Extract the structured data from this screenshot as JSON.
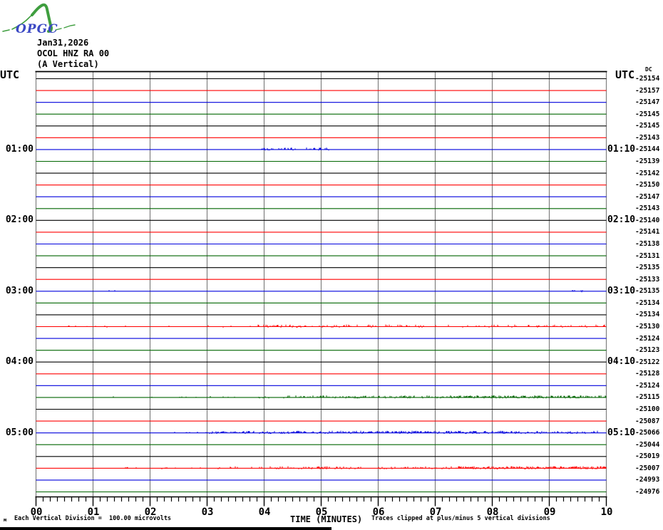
{
  "logo": {
    "text": "OPGC",
    "green": "#3f9e3f",
    "blue": "#3b49c4"
  },
  "header": {
    "date": "Jan31,2026",
    "station": "OCOL HNZ RA 00",
    "component": "(A Vertical)"
  },
  "axis_labels": {
    "utc_left": "UTC",
    "utc_right": "UTC",
    "dc": "DC",
    "x_title": "TIME (MINUTES)"
  },
  "footnotes": {
    "left_mark": "м",
    "left": "Each Vertical Division =  100.00 microvolts",
    "right": "Traces clipped at plus/minus 5 vertical divisions"
  },
  "x_ticks": [
    "00",
    "01",
    "02",
    "03",
    "04",
    "05",
    "06",
    "07",
    "08",
    "09",
    "10"
  ],
  "left_times": [
    {
      "row": 6,
      "label": "01:00"
    },
    {
      "row": 12,
      "label": "02:00"
    },
    {
      "row": 18,
      "label": "03:00"
    },
    {
      "row": 24,
      "label": "04:00"
    },
    {
      "row": 30,
      "label": "05:00"
    }
  ],
  "right_times": [
    {
      "row": 6,
      "label": "01:10"
    },
    {
      "row": 12,
      "label": "02:10"
    },
    {
      "row": 18,
      "label": "03:10"
    },
    {
      "row": 24,
      "label": "04:10"
    },
    {
      "row": 30,
      "label": "05:10"
    }
  ],
  "colors": {
    "grid": "#808080",
    "border": "#000000",
    "trace_colors": {
      "black": "#000000",
      "red": "#ff0000",
      "blue": "#0000dd",
      "green": "#006600"
    }
  },
  "chart_data": {
    "type": "line",
    "title": "OCOL HNZ RA 00 (A Vertical) Jan31,2026 webicorder",
    "xlabel": "TIME (MINUTES)",
    "x_range": [
      0,
      10
    ],
    "x_tick_labels": [
      "00",
      "01",
      "02",
      "03",
      "04",
      "05",
      "06",
      "07",
      "08",
      "09",
      "10"
    ],
    "minor_ticks_per_minute": 8,
    "minutes_per_row": 10,
    "vertical_division_microvolts": 100.0,
    "clip_divisions": 5,
    "rows": [
      {
        "start": "00:00",
        "color": "black",
        "dc": -25154,
        "noise": []
      },
      {
        "start": "00:10",
        "color": "red",
        "dc": -25157,
        "noise": []
      },
      {
        "start": "00:20",
        "color": "blue",
        "dc": -25147,
        "noise": []
      },
      {
        "start": "00:30",
        "color": "green",
        "dc": -25145,
        "noise": []
      },
      {
        "start": "00:40",
        "color": "black",
        "dc": -25145,
        "noise": []
      },
      {
        "start": "00:50",
        "color": "red",
        "dc": -25143,
        "noise": []
      },
      {
        "start": "01:00",
        "color": "blue",
        "dc": -25144,
        "noise": [
          [
            3.95,
            5.15,
            0.3,
            2
          ]
        ]
      },
      {
        "start": "01:10",
        "color": "green",
        "dc": -25139,
        "noise": []
      },
      {
        "start": "01:20",
        "color": "black",
        "dc": -25142,
        "noise": []
      },
      {
        "start": "01:30",
        "color": "red",
        "dc": -25150,
        "noise": []
      },
      {
        "start": "01:40",
        "color": "blue",
        "dc": -25147,
        "noise": []
      },
      {
        "start": "01:50",
        "color": "green",
        "dc": -25143,
        "noise": []
      },
      {
        "start": "02:00",
        "color": "black",
        "dc": -25140,
        "noise": []
      },
      {
        "start": "02:10",
        "color": "red",
        "dc": -25141,
        "noise": []
      },
      {
        "start": "02:20",
        "color": "blue",
        "dc": -25138,
        "noise": []
      },
      {
        "start": "02:30",
        "color": "green",
        "dc": -25131,
        "noise": []
      },
      {
        "start": "02:40",
        "color": "black",
        "dc": -25135,
        "noise": []
      },
      {
        "start": "02:50",
        "color": "red",
        "dc": -25133,
        "noise": []
      },
      {
        "start": "03:00",
        "color": "blue",
        "dc": -25135,
        "noise": [
          [
            1.2,
            1.4,
            0.25,
            1
          ],
          [
            9.4,
            9.6,
            0.25,
            1
          ]
        ]
      },
      {
        "start": "03:10",
        "color": "green",
        "dc": -25134,
        "noise": []
      },
      {
        "start": "03:20",
        "color": "black",
        "dc": -25134,
        "noise": []
      },
      {
        "start": "03:30",
        "color": "red",
        "dc": -25130,
        "noise": [
          [
            0.3,
            3.8,
            0.05,
            1
          ],
          [
            3.8,
            6.2,
            0.35,
            2
          ],
          [
            6.2,
            10,
            0.22,
            2
          ]
        ]
      },
      {
        "start": "03:40",
        "color": "blue",
        "dc": -25124,
        "noise": []
      },
      {
        "start": "03:50",
        "color": "green",
        "dc": -25123,
        "noise": []
      },
      {
        "start": "04:00",
        "color": "black",
        "dc": -25122,
        "noise": []
      },
      {
        "start": "04:10",
        "color": "red",
        "dc": -25128,
        "noise": []
      },
      {
        "start": "04:20",
        "color": "blue",
        "dc": -25124,
        "noise": []
      },
      {
        "start": "04:30",
        "color": "green",
        "dc": -25115,
        "noise": [
          [
            1.3,
            4.4,
            0.06,
            1
          ],
          [
            4.4,
            7.2,
            0.4,
            2
          ],
          [
            7.2,
            10,
            0.6,
            2
          ]
        ]
      },
      {
        "start": "04:40",
        "color": "black",
        "dc": -25100,
        "noise": []
      },
      {
        "start": "04:50",
        "color": "red",
        "dc": -25087,
        "noise": []
      },
      {
        "start": "05:00",
        "color": "blue",
        "dc": -25066,
        "noise": [
          [
            2.3,
            3.0,
            0.15,
            1
          ],
          [
            3.0,
            5.6,
            0.5,
            2
          ],
          [
            5.6,
            8.5,
            0.6,
            2
          ],
          [
            8.5,
            10,
            0.35,
            2
          ]
        ]
      },
      {
        "start": "05:10",
        "color": "green",
        "dc": -25044,
        "noise": []
      },
      {
        "start": "05:20",
        "color": "black",
        "dc": -25019,
        "noise": []
      },
      {
        "start": "05:30",
        "color": "red",
        "dc": -25007,
        "noise": [
          [
            1.5,
            3.4,
            0.06,
            1
          ],
          [
            3.4,
            7.4,
            0.3,
            2
          ],
          [
            7.4,
            10,
            0.65,
            2
          ]
        ]
      },
      {
        "start": "05:40",
        "color": "blue",
        "dc": -24993,
        "noise": []
      },
      {
        "start": "05:50",
        "color": "green",
        "dc": -24976,
        "noise": []
      }
    ]
  }
}
